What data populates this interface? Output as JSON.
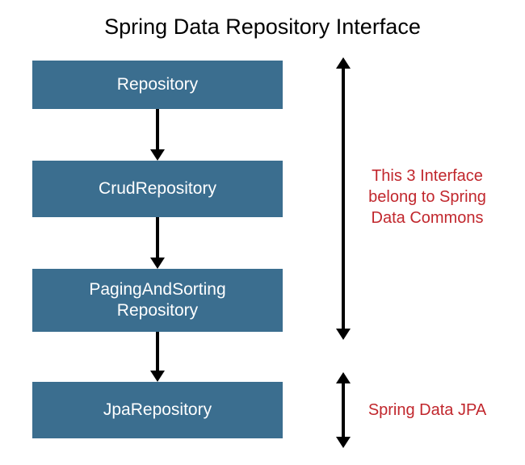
{
  "title": "Spring Data Repository Interface",
  "boxes": {
    "repository": "Repository",
    "crud": "CrudRepository",
    "paging_line1": "PagingAndSorting",
    "paging_line2": "Repository",
    "jpa": "JpaRepository"
  },
  "annotations": {
    "commons_line1": "This 3 Interface",
    "commons_line2": "belong to Spring",
    "commons_line3": "Data Commons",
    "jpa": "Spring Data JPA"
  }
}
